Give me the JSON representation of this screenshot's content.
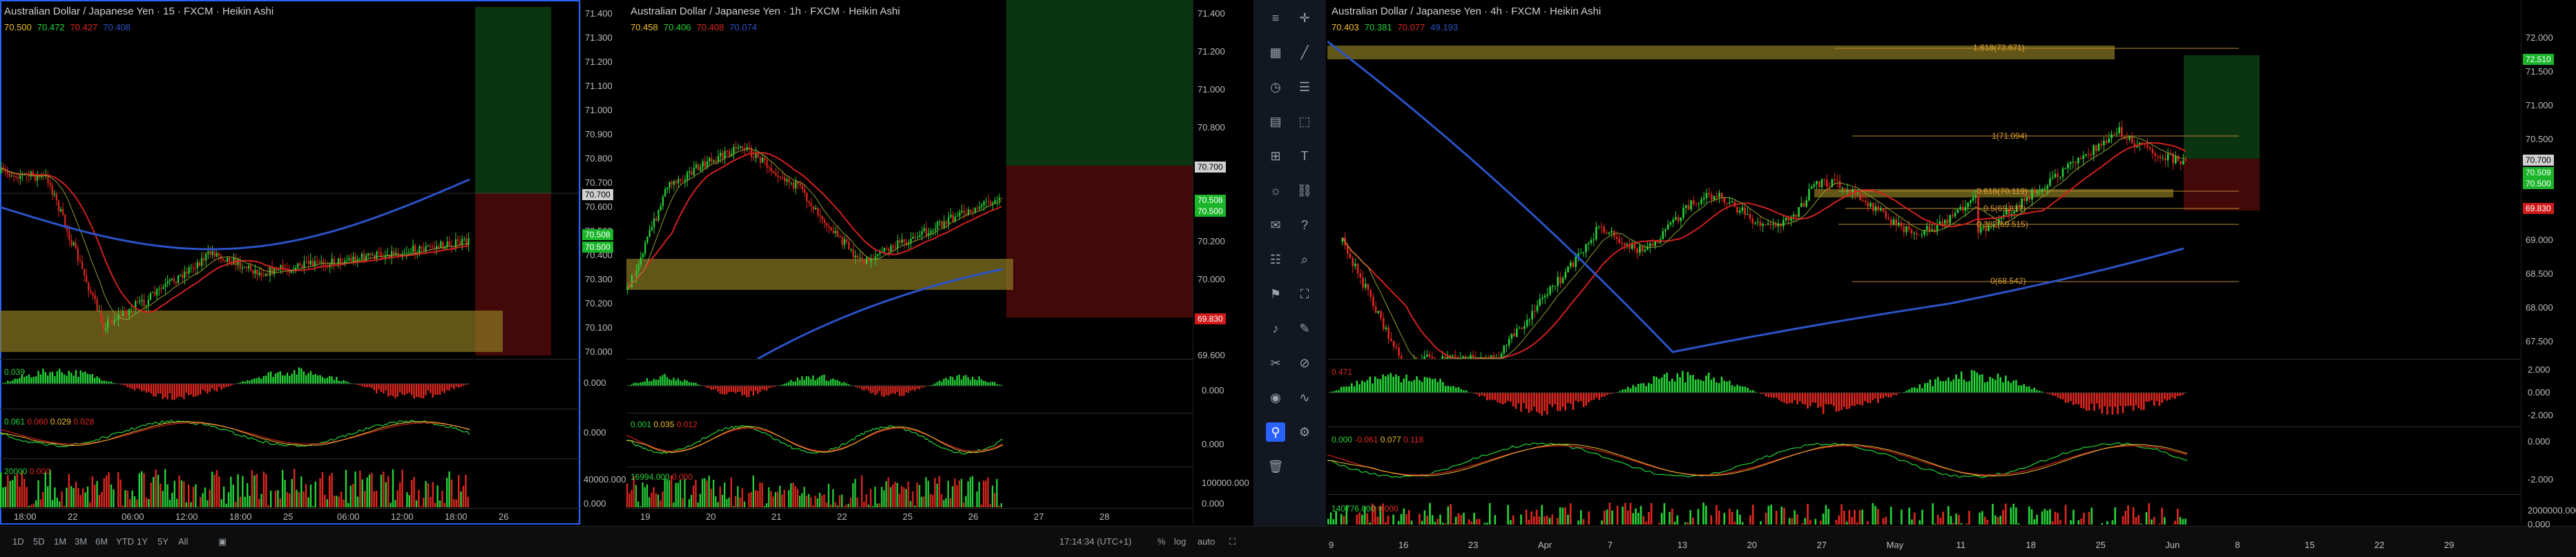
{
  "colors": {
    "up": "#26d43a",
    "down": "#e0271f",
    "blue": "#2962ff",
    "ma_red": "#d32020",
    "ma_blue": "#2c53c8",
    "zone": "#8a7a22",
    "green_tag": "#1bb52a",
    "red_tag": "#d11a1a",
    "white_tag": "#cfcfcf"
  },
  "pane1": {
    "title": "Australian Dollar / Japanese Yen · 15 · FXCM · Heikin Ashi",
    "ohlc": [
      "70.500",
      "70.472",
      "70.427",
      "70.408"
    ],
    "price_ticks": [
      "71.400",
      "71.300",
      "71.200",
      "71.100",
      "71.000",
      "70.900",
      "70.800",
      "70.700",
      "70.600",
      "70.500",
      "70.400",
      "70.300",
      "70.200",
      "70.100",
      "70.000"
    ],
    "tags": {
      "white": "70.700",
      "green1": "70.508",
      "green2": "70.500"
    },
    "macd_label": "0.039",
    "macd_zero": "0.000",
    "osc_label": [
      "0.061",
      "0.060",
      "0.029",
      "0.028"
    ],
    "osc_zero": "0.000",
    "vol_label": "20000",
    "vol_val": "0.000",
    "vol_ticks": [
      "40000.000",
      "0.000"
    ],
    "x_ticks": [
      "18:00",
      "22",
      "06:00",
      "12:00",
      "18:00",
      "25",
      "06:00",
      "12:00",
      "18:00",
      "26"
    ]
  },
  "pane2": {
    "title": "Australian Dollar / Japanese Yen · 1h · FXCM · Heikin Ashi",
    "ohlc": [
      "70.458",
      "70.406",
      "70.408",
      "70.074"
    ],
    "price_ticks": [
      "71.400",
      "71.200",
      "71.000",
      "70.800",
      "70.600",
      "70.400",
      "70.200",
      "70.000",
      "69.800",
      "69.600"
    ],
    "tags": {
      "white": "70.700",
      "green1": "70.508",
      "green2": "70.500",
      "red": "69.830"
    },
    "macd_zero": "0.000",
    "osc_label": [
      "0.001",
      "0.035",
      "0.012"
    ],
    "osc_zero": "0.000",
    "vol_label": "16994.000",
    "vol_val": "0.000",
    "vol_ticks": [
      "100000.000",
      "0.000"
    ],
    "x_ticks": [
      "19",
      "20",
      "21",
      "22",
      "25",
      "26",
      "27",
      "28"
    ]
  },
  "pane3": {
    "title": "Australian Dollar / Japanese Yen · 4h · FXCM · Heikin Ashi",
    "ohlc": [
      "70.403",
      "70.381",
      "70.077",
      "49.193"
    ],
    "price_ticks": [
      "72.000",
      "71.500",
      "71.000",
      "70.500",
      "70.000",
      "69.500",
      "69.000",
      "68.500",
      "68.000",
      "67.500"
    ],
    "tags": {
      "green_top": "72.510",
      "white": "70.700",
      "green1": "70.509",
      "green2": "70.500",
      "red": "69.830"
    },
    "fib": {
      "a": "1.618(72.671)",
      "b": "1(71.094)",
      "c": "0.618(70.119)",
      "d": "0.5(69.817)",
      "e": "0.382(69.515)",
      "f": "0(68.542)"
    },
    "macd_label": "0.471",
    "macd_ticks": [
      "2.000",
      "0.000",
      "-2.000"
    ],
    "osc_label": [
      "0.000",
      "-0.061",
      "0.077",
      "0.118"
    ],
    "osc_ticks": [
      "0.000",
      "-2.000"
    ],
    "vol_label": "140776.000",
    "vol_val": "0.000",
    "vol_ticks": [
      "2000000.000",
      "0.000"
    ],
    "x_ticks": [
      "9",
      "16",
      "23",
      "Apr",
      "7",
      "13",
      "20",
      "27",
      "May",
      "11",
      "18",
      "25",
      "Jun",
      "8",
      "15",
      "22",
      "29"
    ]
  },
  "bottom": {
    "ranges": [
      "1D",
      "5D",
      "1M",
      "3M",
      "6M",
      "YTD",
      "1Y",
      "5Y",
      "All"
    ],
    "clock": "17:14:34 (UTC+1)",
    "pct": "%",
    "log": "log",
    "auto": "auto"
  }
}
